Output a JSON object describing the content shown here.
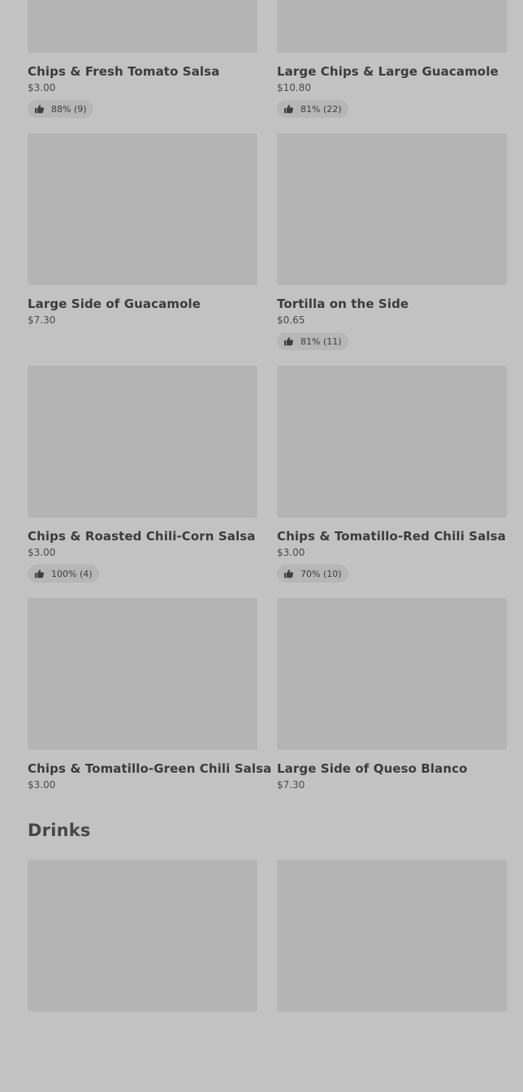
{
  "items": [
    {
      "name": "Chips & Fresh Tomato Salsa",
      "price": "$3.00",
      "rating": "88% (9)"
    },
    {
      "name": "Large Chips & Large Guacamole",
      "price": "$10.80",
      "rating": "81% (22)"
    },
    {
      "name": "Large Side of Guacamole",
      "price": "$7.30",
      "rating": ""
    },
    {
      "name": "Tortilla on the Side",
      "price": "$0.65",
      "rating": "81% (11)"
    },
    {
      "name": "Chips & Roasted Chili-Corn Salsa",
      "price": "$3.00",
      "rating": "100% (4)"
    },
    {
      "name": "Chips & Tomatillo-Red Chili Salsa",
      "price": "$3.00",
      "rating": "70% (10)"
    },
    {
      "name": "Chips & Tomatillo-Green Chili Salsa",
      "price": "$3.00",
      "rating": ""
    },
    {
      "name": "Large Side of Queso Blanco",
      "price": "$7.30",
      "rating": ""
    }
  ],
  "drinks_section": {
    "title": "Drinks"
  },
  "drinks_cards_count": 2
}
